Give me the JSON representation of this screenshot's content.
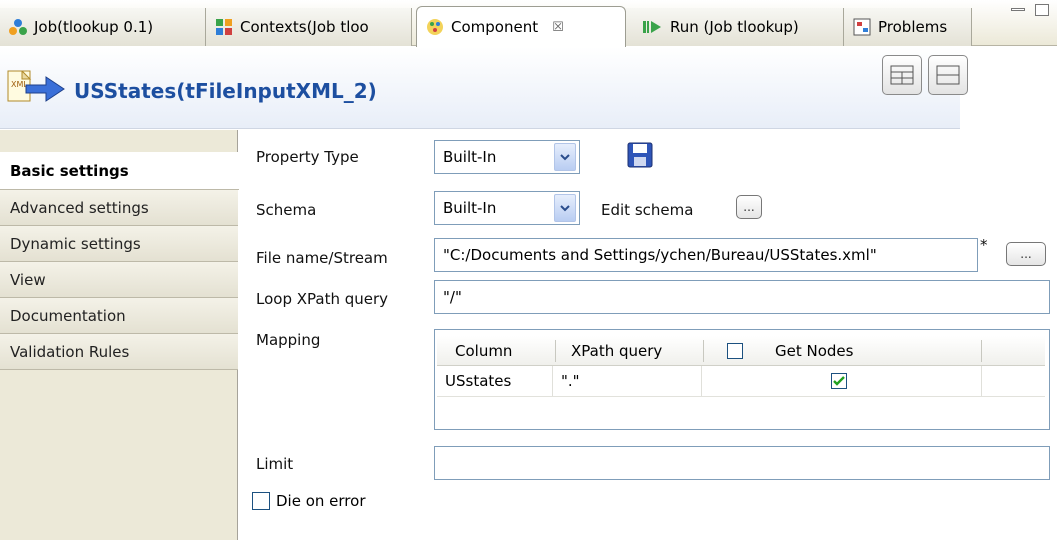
{
  "tabs": [
    {
      "label": "Job(tlookup 0.1)",
      "icon": "job-icon"
    },
    {
      "label": "Contexts(Job tloo",
      "icon": "contexts-icon"
    },
    {
      "label": "Component",
      "icon": "component-icon",
      "active": true,
      "close": "☒"
    },
    {
      "label": "Run (Job tlookup)",
      "icon": "run-icon"
    },
    {
      "label": "Problems",
      "icon": "problems-icon"
    }
  ],
  "header": {
    "title": "USStates(tFileInputXML_2)",
    "icon": "xml-input-icon"
  },
  "sidebar": {
    "items": [
      {
        "label": "Basic settings",
        "selected": true
      },
      {
        "label": "Advanced settings"
      },
      {
        "label": "Dynamic settings"
      },
      {
        "label": "View"
      },
      {
        "label": "Documentation"
      },
      {
        "label": "Validation Rules"
      }
    ]
  },
  "form": {
    "property_type": {
      "label": "Property Type",
      "value": "Built-In"
    },
    "schema": {
      "label": "Schema",
      "value": "Built-In",
      "edit_label": "Edit schema"
    },
    "file_name": {
      "label": "File name/Stream",
      "value": "\"C:/Documents and Settings/ychen/Bureau/USStates.xml\"",
      "marker": "*"
    },
    "loop_xpath": {
      "label": "Loop XPath query",
      "value": "\"/\""
    },
    "mapping": {
      "label": "Mapping",
      "headers": {
        "column": "Column",
        "xpath": "XPath query",
        "get_nodes": "Get Nodes"
      },
      "rows": [
        {
          "column": "USstates",
          "xpath": "\".\"",
          "get_nodes": true
        }
      ]
    },
    "limit": {
      "label": "Limit",
      "value": ""
    },
    "die_on_error": {
      "label": "Die on error",
      "checked": false
    },
    "dots": "..."
  },
  "colors": {
    "title": "#1d4fa0",
    "panel": "#ece9d8",
    "border": "#7f9db9"
  }
}
